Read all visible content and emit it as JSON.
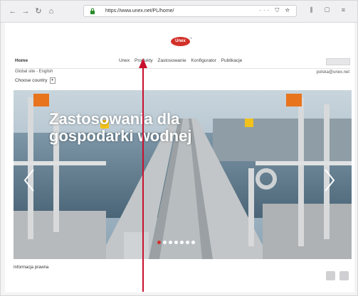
{
  "browser": {
    "url": "https://www.unex.net/PL/home/",
    "nav_icons": [
      "back-icon",
      "forward-icon",
      "reload-icon",
      "home-icon"
    ]
  },
  "site": {
    "logo_text": "Unex",
    "menu": {
      "home": "Home",
      "items": [
        "Unex",
        "Produkty",
        "Zastosowanie",
        "Konfigurator",
        "Publikacje"
      ]
    },
    "global_site": "Global site - English",
    "choose_country": "Choose country",
    "email": "polska@unex.net"
  },
  "hero": {
    "title_line1": "Zastosowania dla",
    "title_line2": "gospodarki wodnej",
    "dots_count": 7,
    "active_dot": 0
  },
  "footer": {
    "legal": "Informacja prawna"
  },
  "colors": {
    "brand": "#d2312a",
    "annotation": "#c8102e"
  }
}
